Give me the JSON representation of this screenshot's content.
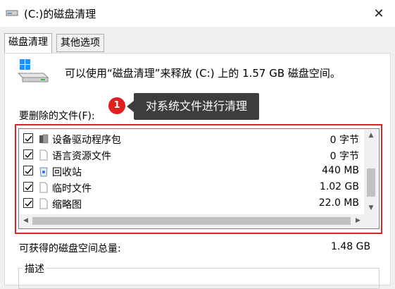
{
  "window": {
    "title": "(C:)的磁盘清理",
    "close_glyph": "✕"
  },
  "tabs": [
    {
      "label": "磁盘清理",
      "active": true
    },
    {
      "label": "其他选项",
      "active": false
    }
  ],
  "main": {
    "info_text": "可以使用“磁盘清理”来释放 (C:) 上的 1.57 GB 磁盘空间。",
    "files_label": "要删除的文件(F):",
    "callout": {
      "number": "1",
      "text": "对系统文件进行清理"
    },
    "files": [
      {
        "name": "设备驱动程序包",
        "size": "0 字节",
        "checked": true,
        "icon": "driver-package-icon"
      },
      {
        "name": "语言资源文件",
        "size": "0 字节",
        "checked": true,
        "icon": "file-icon"
      },
      {
        "name": "回收站",
        "size": "440 MB",
        "checked": true,
        "icon": "recycle-bin-icon"
      },
      {
        "name": "临时文件",
        "size": "1.02 GB",
        "checked": true,
        "icon": "file-icon"
      },
      {
        "name": "缩略图",
        "size": "22.0 MB",
        "checked": true,
        "icon": "file-icon"
      }
    ],
    "total_label": "可获得的磁盘空间总量:",
    "total_value": "1.48 GB",
    "description_label": "描述"
  },
  "colors": {
    "highlight": "#d9262a",
    "tooltip_bg": "#3d3d3d",
    "callout_badge": "#e21f1f"
  }
}
